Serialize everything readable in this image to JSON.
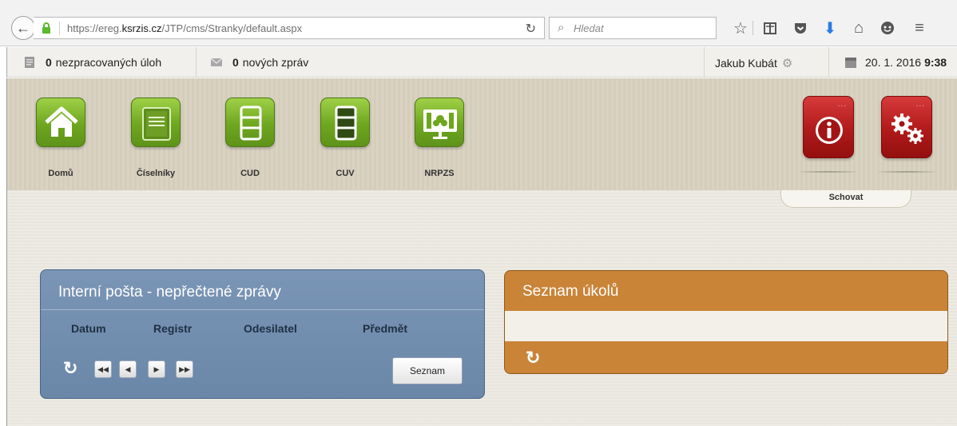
{
  "browser": {
    "url_prefix": "https://ereg.",
    "url_domain": "ksrzis.cz",
    "url_path": "/JTP/cms/Stranky/default.aspx",
    "search_placeholder": "Hledat"
  },
  "status": {
    "tasks_count": "0",
    "tasks_label": "nezpracovaných úloh",
    "messages_count": "0",
    "messages_label": "nových zpráv",
    "user_name": "Jakub Kubát",
    "date": "20. 1. 2016",
    "time": "9:38"
  },
  "tiles": [
    {
      "label": "Domů",
      "icon": "home-icon"
    },
    {
      "label": "Číselníky",
      "icon": "codebook-icon"
    },
    {
      "label": "CUD",
      "icon": "cud-register-icon"
    },
    {
      "label": "CUV",
      "icon": "cuv-register-icon"
    },
    {
      "label": "NRPZS",
      "icon": "nrpzs-icon"
    }
  ],
  "right_tiles": [
    {
      "icon": "info-icon"
    },
    {
      "icon": "settings-gears-icon"
    }
  ],
  "hide_tab_label": "Schovat",
  "mail_panel": {
    "title": "Interní pošta - nepřečtené zprávy",
    "columns": [
      "Datum",
      "Registr",
      "Odesilatel",
      "Předmět"
    ],
    "list_button": "Seznam"
  },
  "tasks_panel": {
    "title": "Seznam úkolů"
  },
  "colors": {
    "tile_green": "#6fa620",
    "tile_red": "#b01a1a",
    "mail_panel": "#7a95b5",
    "tasks_panel": "#c98438"
  }
}
